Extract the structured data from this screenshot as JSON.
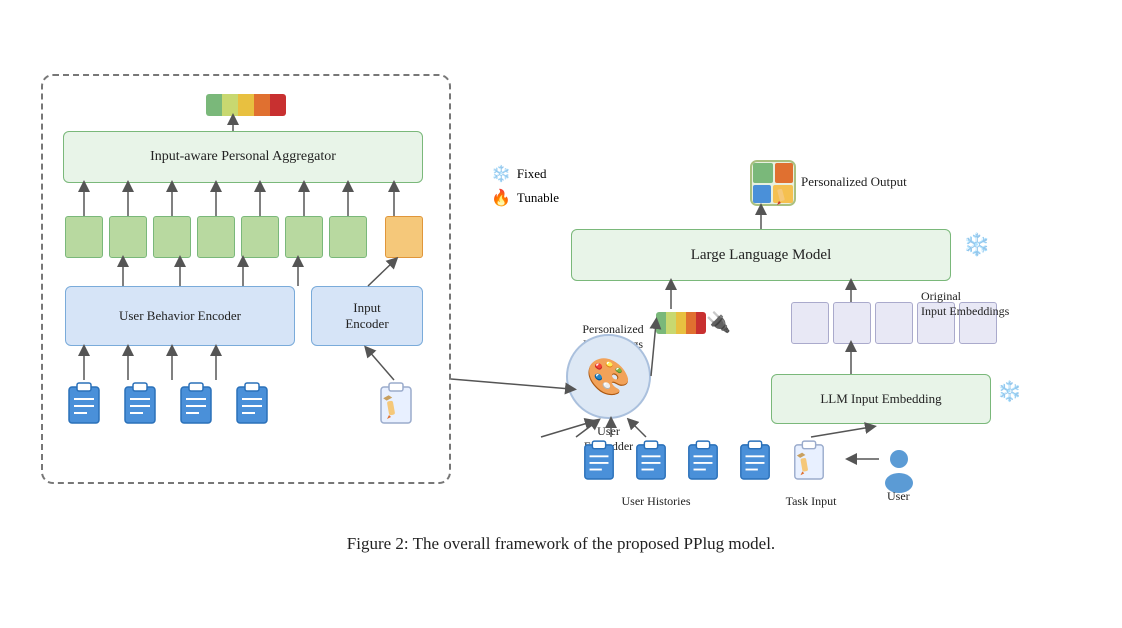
{
  "caption": "Figure 2: The overall framework of the proposed PPlug model.",
  "legend": {
    "fixed_label": "Fixed",
    "tunable_label": "Tunable",
    "fixed_icon": "❄",
    "tunable_icon": "🔥"
  },
  "left_panel": {
    "aggregator_label": "Input-aware Personal Aggregator",
    "behavior_encoder_label": "User Behavior Encoder",
    "input_encoder_label": "Input\nEncoder"
  },
  "right_panel": {
    "llm_label": "Large Language Model",
    "llm_input_embedding_label": "LLM Input Embedding",
    "personalized_output_label": "Personalized Output",
    "personalized_embeddings_label": "Personalized\nEmbeddings",
    "original_input_embeddings_label": "Original\nInput Embeddings",
    "user_embedder_label": "User\nEmbedder",
    "user_histories_label": "User Histories",
    "task_input_label": "Task Input",
    "user_label": "User"
  },
  "colors": {
    "green_box": "#e8f4e8",
    "green_border": "#7ab87a",
    "blue_box": "#d6e4f7",
    "blue_border": "#7aabda",
    "embed_green": "#b8d9a0",
    "embed_orange": "#f5c87a",
    "embed_orig": "#e8e8f5",
    "accent_blue": "#4a90d9",
    "dashed_border": "#777"
  }
}
